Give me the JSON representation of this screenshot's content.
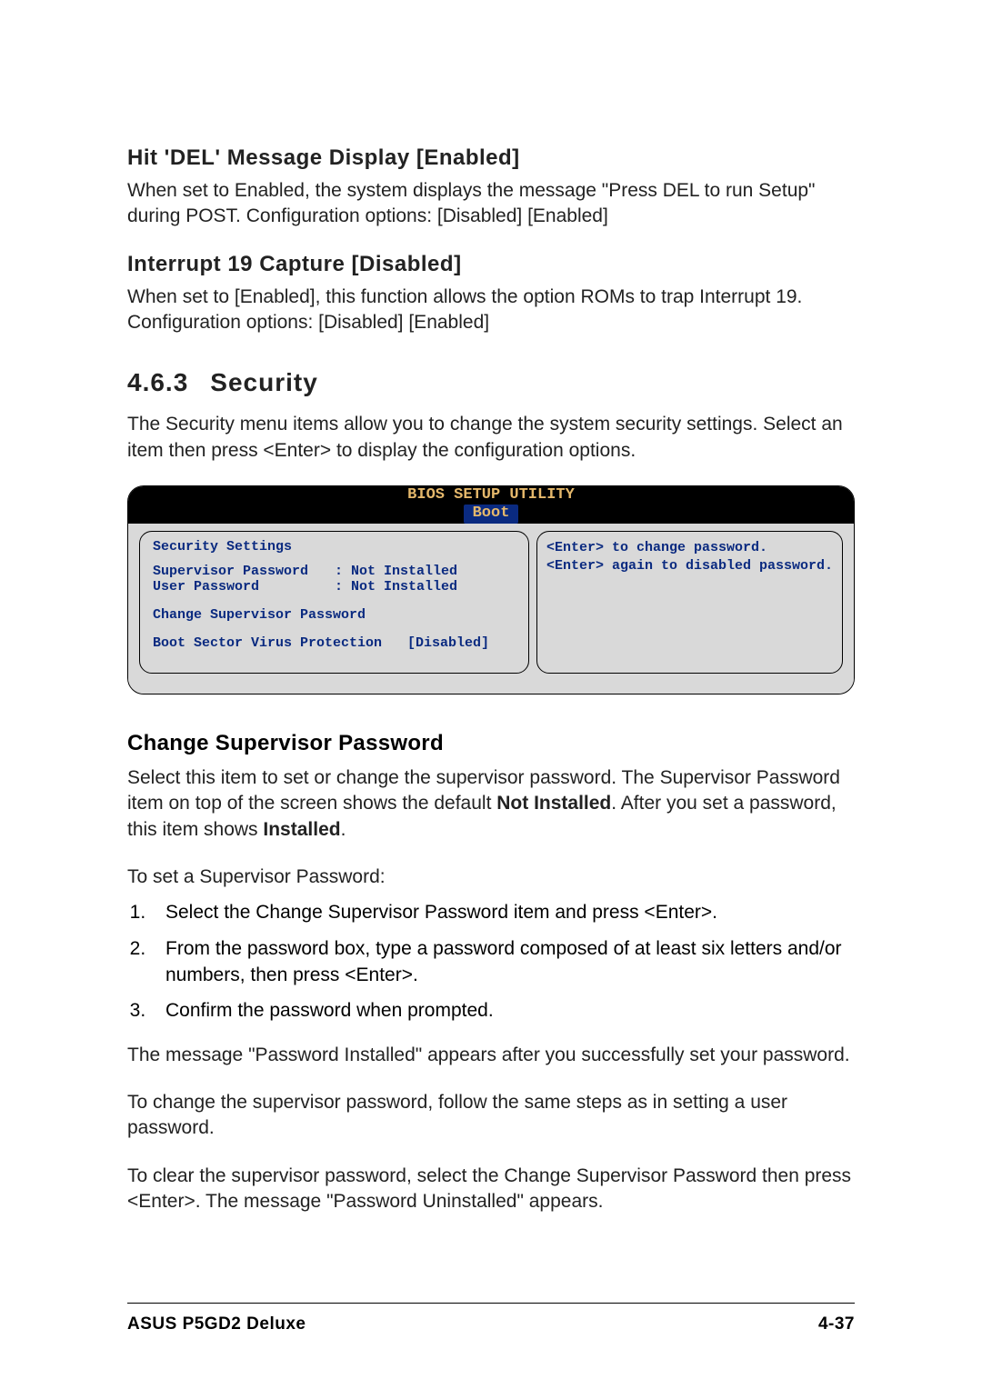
{
  "option1": {
    "title": "Hit 'DEL' Message Display [Enabled]",
    "body": "When set to Enabled, the system displays the message \"Press DEL to run Setup\" during POST. Configuration options: [Disabled] [Enabled]"
  },
  "option2": {
    "title": "Interrupt 19 Capture [Disabled]",
    "body": "When set to [Enabled], this function allows the option ROMs to trap Interrupt 19. Configuration options: [Disabled] [Enabled]"
  },
  "section": {
    "number": "4.6.3",
    "title": "Security",
    "intro": "The Security menu items allow you to change the system security settings. Select an item then press <Enter> to display the configuration options."
  },
  "bios": {
    "title_line1": "BIOS SETUP UTILITY",
    "tab": "Boot",
    "left_heading": "Security Settings",
    "left_row1_label": "Supervisor Password",
    "left_row1_value": ": Not Installed",
    "left_row2_label": "User Password",
    "left_row2_value": ": Not Installed",
    "left_row3": "Change Supervisor Password",
    "left_row4_label": "Boot Sector Virus Protection",
    "left_row4_value": "[Disabled]",
    "right_text": "<Enter> to change password.\n<Enter> again to disabled password."
  },
  "changeSupervisor": {
    "title": "Change Supervisor Password",
    "para1_a": "Select this item to set or change the supervisor password. The Supervisor Password item on top of the screen shows the default ",
    "para1_bold1": "Not Installed",
    "para1_b": ". After you set a password, this item shows ",
    "para1_bold2": "Installed",
    "para1_c": ".",
    "para2": "To set a Supervisor Password:",
    "steps": [
      "Select the Change Supervisor Password item and press <Enter>.",
      "From the password box, type a password composed of at least six letters and/or numbers, then press <Enter>.",
      "Confirm the password when prompted."
    ],
    "para3": "The message \"Password Installed\" appears after you successfully set your password.",
    "para4": "To change the supervisor password, follow the same steps as in setting a user password.",
    "para5": "To clear the supervisor password, select the Change Supervisor Password then press <Enter>. The message \"Password Uninstalled\" appears."
  },
  "footer": {
    "left": "ASUS P5GD2 Deluxe",
    "right": "4-37"
  }
}
